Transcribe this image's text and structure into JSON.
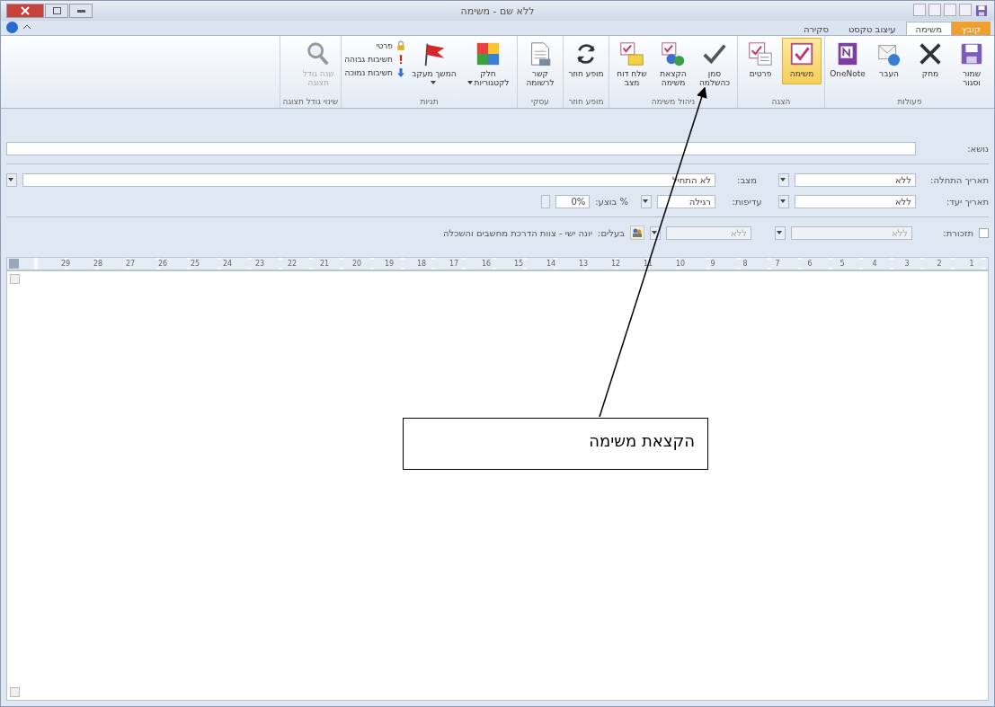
{
  "window": {
    "title": "ללא שם - משימה"
  },
  "tabs": [
    {
      "label": "קובץ",
      "kind": "file",
      "selected": false
    },
    {
      "label": "משימה",
      "kind": "tab",
      "selected": true
    },
    {
      "label": "עיצוב טקסט",
      "kind": "tab",
      "selected": false
    },
    {
      "label": "סקירה",
      "kind": "tab",
      "selected": false
    }
  ],
  "ribbon_groups": [
    {
      "label": "פעולות",
      "buttons": [
        {
          "label": "שמור וסגור",
          "kind": "large",
          "disabled": false
        },
        {
          "label": "מחק",
          "kind": "large",
          "disabled": false
        },
        {
          "label": "העבר",
          "kind": "large",
          "disabled": false
        },
        {
          "label": "OneNote",
          "kind": "large",
          "disabled": false
        }
      ]
    },
    {
      "label": "הצגה",
      "buttons": [
        {
          "label": "משימה",
          "kind": "large",
          "selected": true,
          "disabled": false
        },
        {
          "label": "פרטים",
          "kind": "large",
          "selected": false,
          "disabled": false
        }
      ]
    },
    {
      "label": "ניהול משימה",
      "buttons": [
        {
          "label": "סמן כהשלמה",
          "kind": "large",
          "disabled": false
        },
        {
          "label": "הקצאת משימה",
          "kind": "large",
          "disabled": false
        },
        {
          "label": "שלח דוח מצב",
          "kind": "large",
          "disabled": false
        }
      ]
    },
    {
      "label": "מופע חוזר",
      "buttons": [
        {
          "label": "מופע חוזר",
          "kind": "large",
          "disabled": false
        }
      ]
    },
    {
      "label": "עסקי",
      "buttons": [
        {
          "label": "קשר לרשומה",
          "kind": "large",
          "disabled": false
        }
      ]
    },
    {
      "label": "תגיות",
      "buttons": [
        {
          "label": "חלק לקטגוריות",
          "kind": "dropdown",
          "disabled": false
        },
        {
          "label": "המשך מעקב",
          "kind": "dropdown",
          "disabled": false
        },
        {
          "label": "פרטי",
          "kind": "small",
          "disabled": false
        },
        {
          "label": "חשיבות גבוהה",
          "kind": "small",
          "disabled": false
        },
        {
          "label": "חשיבות נמוכה",
          "kind": "small",
          "disabled": false
        }
      ]
    },
    {
      "label": "שינוי גודל תצוגה",
      "buttons": [
        {
          "label": "שנה גודל תצוגה",
          "kind": "large",
          "disabled": true
        }
      ]
    }
  ],
  "subject": {
    "label": "נושא:"
  },
  "start_date": {
    "label": "תאריך התחלה:",
    "value": "ללא"
  },
  "status": {
    "label": "מצב:",
    "value": "לא התחיל"
  },
  "due_date": {
    "label": "תאריך יעד:",
    "value": "ללא"
  },
  "priority": {
    "label": "עדיפות:",
    "value": "רגילה"
  },
  "percent_complete": {
    "label": "% בוצע:",
    "value": "0%"
  },
  "reminder": {
    "label": "תזכורת:",
    "checked": false,
    "date": "ללא",
    "time": "ללא"
  },
  "owner": {
    "label": "בעלים:",
    "value": "יונה ישי - צוות הדרכת מחשבים והשכלה"
  },
  "ruler": {
    "numbers": [
      "1",
      "2",
      "3",
      "4",
      "5",
      "6",
      "7",
      "8",
      "9",
      "10",
      "11",
      "12",
      "13",
      "14",
      "15",
      "16",
      "17",
      "18",
      "19",
      "20",
      "21",
      "22",
      "23",
      "24",
      "25",
      "26",
      "27",
      "28",
      "29"
    ]
  },
  "callout": {
    "text": "הקצאת משימה"
  }
}
